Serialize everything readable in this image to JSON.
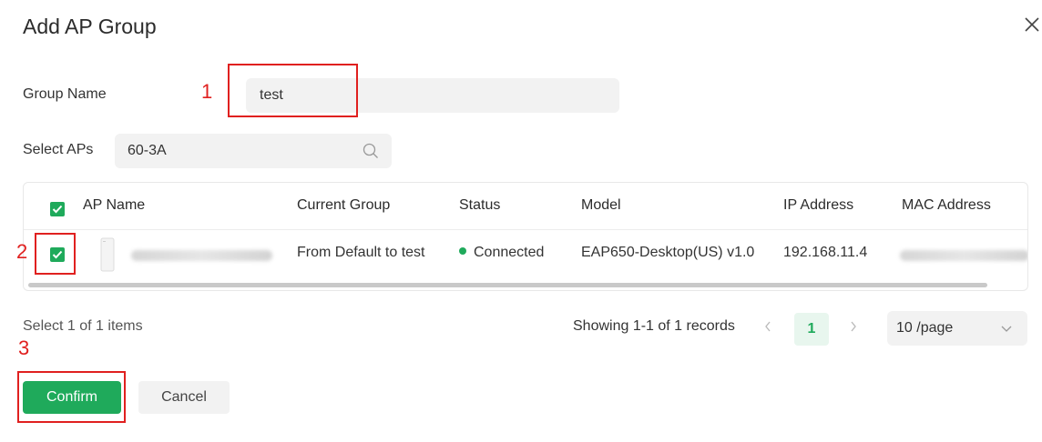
{
  "dialog": {
    "title": "Add AP Group"
  },
  "form": {
    "group_name_label": "Group Name",
    "group_name_value": "test",
    "select_aps_label": "Select APs",
    "search_value": "60-3A"
  },
  "annotations": [
    "1",
    "2",
    "3"
  ],
  "table": {
    "columns": [
      "AP Name",
      "Current Group",
      "Status",
      "Model",
      "IP Address",
      "MAC Address"
    ],
    "rows": [
      {
        "checked": true,
        "current_group": "From Default to test",
        "status": "Connected",
        "model": "EAP650-Desktop(US) v1.0",
        "ip_address": "192.168.11.4"
      }
    ]
  },
  "footer": {
    "selection_text": "Select 1 of 1 items",
    "records_text": "Showing 1-1 of 1 records",
    "current_page": "1",
    "page_size": "10 /page"
  },
  "actions": {
    "confirm_label": "Confirm",
    "cancel_label": "Cancel"
  },
  "colors": {
    "accent": "#1faa5b",
    "annotation": "#e0201f",
    "field_bg": "#f2f2f2"
  }
}
